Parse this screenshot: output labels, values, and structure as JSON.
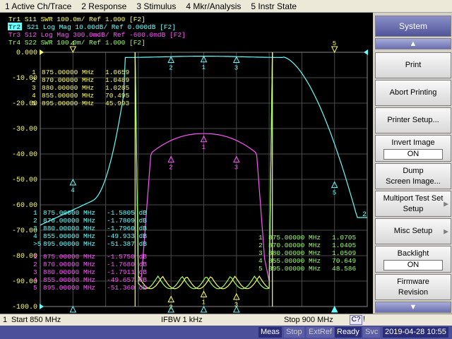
{
  "menu": [
    "1 Active Ch/Trace",
    "2 Response",
    "3 Stimulus",
    "4 Mkr/Analysis",
    "5 Instr State"
  ],
  "traces": [
    {
      "id": "Tr1",
      "label": "Tr1  S11  SWR 100.0m/ Ref 1.000  [F2]",
      "color": "#ffff66",
      "active": false
    },
    {
      "id": "Tr2",
      "label": "S21  Log Mag 10.00dB/ Ref 0.000dB  [F2]",
      "color": "#66ffff",
      "active": true
    },
    {
      "id": "Tr3",
      "label": "Tr3  S12  Log Mag 300.0mdB/ Ref -600.0mdB  [F2]",
      "color": "#ff55ff",
      "active": false
    },
    {
      "id": "Tr4",
      "label": "Tr4  S22  SWR 100.0m/ Ref 1.000  [F2]",
      "color": "#99ff66",
      "active": false
    }
  ],
  "yaxis": [
    "0.000",
    "-10.00",
    "-20.00",
    "-30.00",
    "-40.00",
    "-50.00",
    "-60.00",
    "-70.00",
    "-80.00",
    "-90.00",
    "-100.0"
  ],
  "markers_tr1": [
    {
      "n": "1",
      "f": "875.00000 MHz",
      "v": "1.0659"
    },
    {
      "n": "2",
      "f": "870.00000 MHz",
      "v": "1.0489"
    },
    {
      "n": "3",
      "f": "880.00000 MHz",
      "v": "1.0285"
    },
    {
      "n": "4",
      "f": "855.00000 MHz",
      "v": "70.495"
    },
    {
      "n": "5",
      "f": "895.00000 MHz",
      "v": "45.993"
    }
  ],
  "markers_tr2": [
    {
      "n": "1",
      "f": "875.00000 MHz",
      "v": "-1.5805  dB"
    },
    {
      "n": "2",
      "f": "870.00000 MHz",
      "v": "-1.7809  dB"
    },
    {
      "n": "3",
      "f": "880.00000 MHz",
      "v": "-1.7960  dB"
    },
    {
      "n": "4",
      "f": "855.00000 MHz",
      "v": "-49.933  dB"
    },
    {
      "n": ">5",
      "f": "895.00000 MHz",
      "v": "-51.387  dB"
    }
  ],
  "markers_tr3": [
    {
      "n": "1",
      "f": "875.00000 MHz",
      "v": "-1.5750  dB"
    },
    {
      "n": "2",
      "f": "870.00000 MHz",
      "v": "-1.7680  dB"
    },
    {
      "n": "3",
      "f": "880.00000 MHz",
      "v": "-1.7911  dB"
    },
    {
      "n": "4",
      "f": "855.00000 MHz",
      "v": "-49.657  dB"
    },
    {
      "n": "5",
      "f": "895.00000 MHz",
      "v": "-51.360  dB"
    }
  ],
  "markers_tr4": [
    {
      "n": "1",
      "f": "875.00000 MHz",
      "v": "1.0705"
    },
    {
      "n": "2",
      "f": "870.00000 MHz",
      "v": "1.0405"
    },
    {
      "n": "3",
      "f": "880.00000 MHz",
      "v": "1.0509"
    },
    {
      "n": "4",
      "f": "855.00000 MHz",
      "v": "70.649"
    },
    {
      "n": "5",
      "f": "895.00000 MHz",
      "v": "48.586"
    }
  ],
  "marker_labels": [
    "1",
    "2",
    "3",
    "4",
    "5"
  ],
  "trace_end_label": "2",
  "softkeys": {
    "header": "System",
    "print": "Print",
    "abort": "Abort Printing",
    "printer_setup": "Printer Setup...",
    "invert_label": "Invert Image",
    "invert_value": "ON",
    "dump_line1": "Dump",
    "dump_line2": "Screen Image...",
    "multiport_line1": "Multiport Test Set",
    "multiport_line2": "Setup",
    "misc": "Misc Setup",
    "backlight_label": "Backlight",
    "backlight_value": "ON",
    "firmware_line1": "Firmware",
    "firmware_line2": "Revision",
    "scroll_up_icon": "triangle-up-icon",
    "scroll_down_icon": "triangle-down-icon"
  },
  "status1": {
    "channel": "1",
    "start": "Start 850 MHz",
    "ifbw": "IFBW 1 kHz",
    "stop": "Stop 900 MHz",
    "c2": "C?",
    "help": "!"
  },
  "status2": {
    "meas": "Meas",
    "stop": "Stop",
    "extref": "ExtRef",
    "ready": "Ready",
    "svc": "Svc",
    "datetime": "2019-04-28 10:55"
  },
  "colors": {
    "tr1": "#ffff66",
    "tr2": "#66ffff",
    "tr3": "#ff55ff",
    "tr4": "#99ff66",
    "grid": "#555555"
  }
}
